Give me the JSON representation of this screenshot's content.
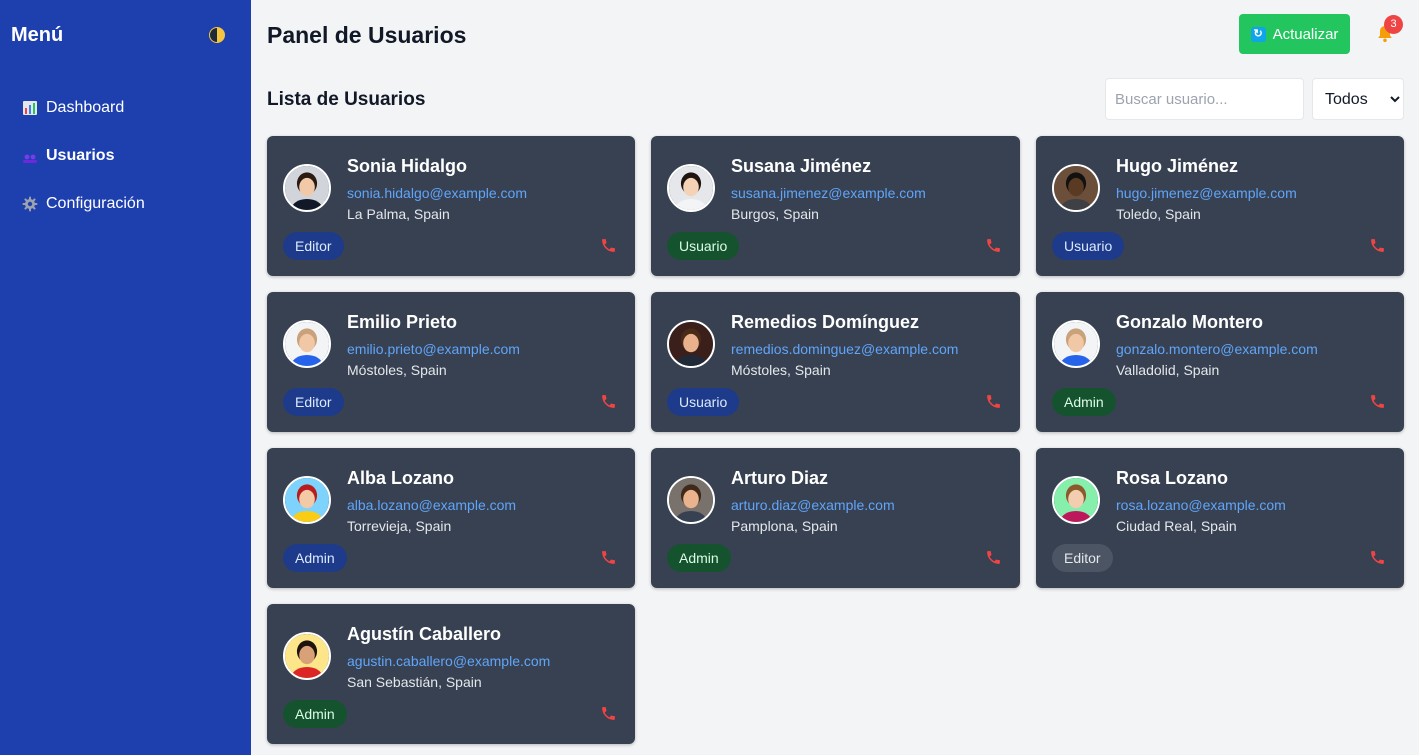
{
  "sidebar": {
    "title": "Menú",
    "items": [
      {
        "label": "Dashboard",
        "icon": "bar-chart-icon",
        "active": false
      },
      {
        "label": "Usuarios",
        "icon": "users-icon",
        "active": true
      },
      {
        "label": "Configuración",
        "icon": "gear-icon",
        "active": false
      }
    ]
  },
  "header": {
    "title": "Panel de Usuarios",
    "refresh_label": "Actualizar",
    "notification_count": "3"
  },
  "list": {
    "title": "Lista de Usuarios",
    "search_placeholder": "Buscar usuario...",
    "filter_value": "Todos"
  },
  "colors": {
    "sidebar": "#1e40af",
    "card": "#374151",
    "accent_green": "#22c55e",
    "email": "#60a5fa",
    "phone": "#ef4444"
  },
  "users": [
    {
      "name": "Sonia Hidalgo",
      "email": "sonia.hidalgo@example.com",
      "location": "La Palma, Spain",
      "role": "Editor",
      "badge_style": "blue"
    },
    {
      "name": "Susana Jiménez",
      "email": "susana.jimenez@example.com",
      "location": "Burgos, Spain",
      "role": "Usuario",
      "badge_style": "green"
    },
    {
      "name": "Hugo Jiménez",
      "email": "hugo.jimenez@example.com",
      "location": "Toledo, Spain",
      "role": "Usuario",
      "badge_style": "blue"
    },
    {
      "name": "Emilio Prieto",
      "email": "emilio.prieto@example.com",
      "location": "Móstoles, Spain",
      "role": "Editor",
      "badge_style": "blue"
    },
    {
      "name": "Remedios Domínguez",
      "email": "remedios.dominguez@example.com",
      "location": "Móstoles, Spain",
      "role": "Usuario",
      "badge_style": "blue"
    },
    {
      "name": "Gonzalo Montero",
      "email": "gonzalo.montero@example.com",
      "location": "Valladolid, Spain",
      "role": "Admin",
      "badge_style": "green"
    },
    {
      "name": "Alba Lozano",
      "email": "alba.lozano@example.com",
      "location": "Torrevieja, Spain",
      "role": "Admin",
      "badge_style": "blue"
    },
    {
      "name": "Arturo Diaz",
      "email": "arturo.diaz@example.com",
      "location": "Pamplona, Spain",
      "role": "Admin",
      "badge_style": "green"
    },
    {
      "name": "Rosa Lozano",
      "email": "rosa.lozano@example.com",
      "location": "Ciudad Real, Spain",
      "role": "Editor",
      "badge_style": "gray"
    },
    {
      "name": "Agustín Caballero",
      "email": "agustin.caballero@example.com",
      "location": "San Sebastián, Spain",
      "role": "Admin",
      "badge_style": "green"
    }
  ]
}
